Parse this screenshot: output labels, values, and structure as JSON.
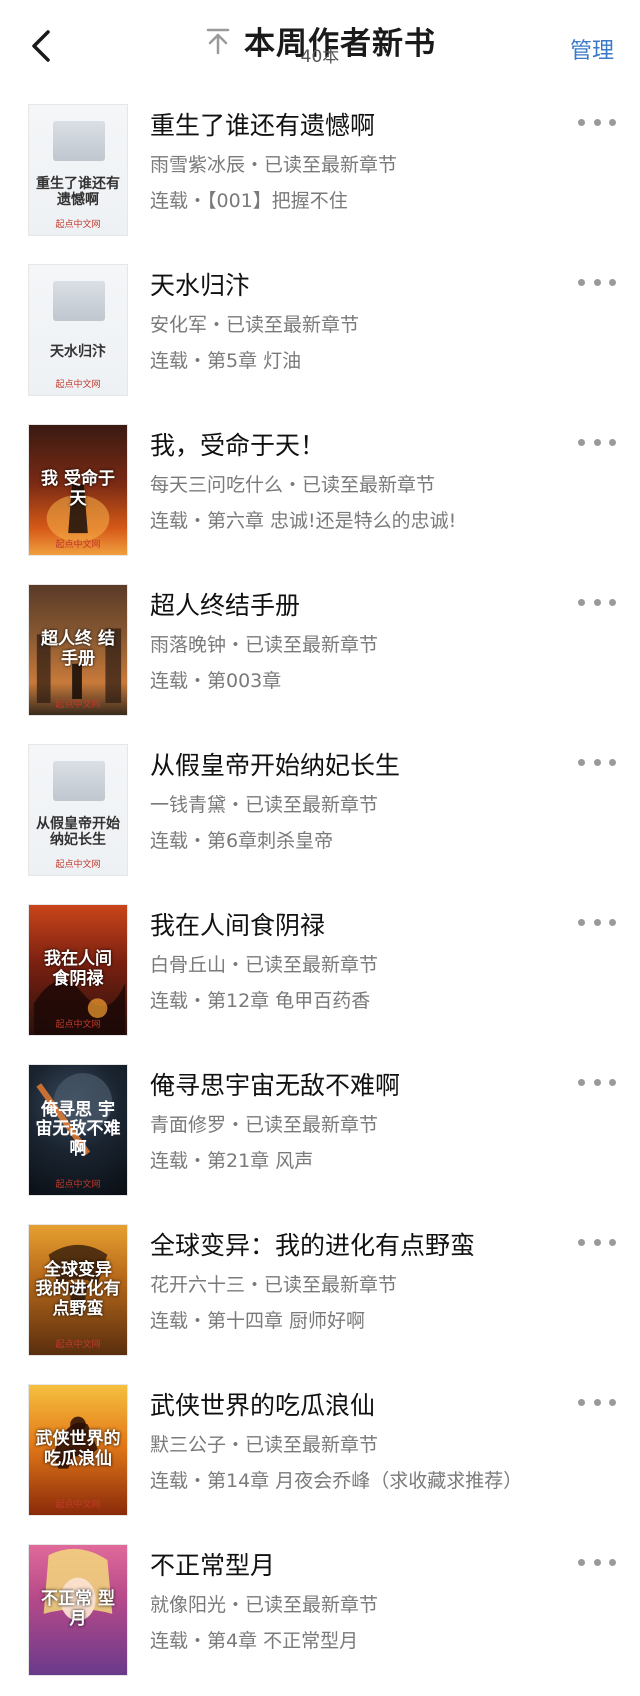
{
  "header": {
    "title": "本周作者新书",
    "count": "40本",
    "manage_label": "管理"
  },
  "icons": {
    "back": "chevron-left-icon",
    "pin": "pin-to-top-icon",
    "more": "more-dots-icon"
  },
  "books": [
    {
      "title": "重生了谁还有遗憾啊",
      "meta": "雨雪紫冰辰・已读至最新章节",
      "latest": "连载・【001】把握不住",
      "cover_text": "重生了谁还有遗憾啊",
      "cover_style": "light",
      "cover_publisher": "起点中文网"
    },
    {
      "title": "天水归汴",
      "meta": "安化军・已读至最新章节",
      "latest": "连载・第5章 灯油",
      "cover_text": "天水归汴",
      "cover_style": "light",
      "cover_publisher": "起点中文网"
    },
    {
      "title": "我，受命于天！",
      "meta": "每天三问吃什么・已读至最新章节",
      "latest": "连载・第六章 忠诚!还是特么的忠诚!",
      "cover_text": "我 受命于天",
      "cover_style": "fire",
      "cover_publisher": "起点中文网"
    },
    {
      "title": "超人终结手册",
      "meta": "雨落晚钟・已读至最新章节",
      "latest": "连载・第003章",
      "cover_text": "超人终 结手册",
      "cover_style": "city",
      "cover_publisher": "起点中文网"
    },
    {
      "title": "从假皇帝开始纳妃长生",
      "meta": "一钱青黛・已读至最新章节",
      "latest": "连载・第6章刺杀皇帝",
      "cover_text": "从假皇帝开始纳妃长生",
      "cover_style": "light",
      "cover_publisher": "起点中文网"
    },
    {
      "title": "我在人间食阴禄",
      "meta": "白骨丘山・已读至最新章节",
      "latest": "连载・第12章 龟甲百药香",
      "cover_text": "我在人间 食阴禄",
      "cover_style": "red",
      "cover_publisher": "起点中文网"
    },
    {
      "title": "俺寻思宇宙无敌不难啊",
      "meta": "青面修罗・已读至最新章节",
      "latest": "连载・第21章 风声",
      "cover_text": "俺寻思 宇宙无敌不难啊",
      "cover_style": "space",
      "cover_publisher": "起点中文网"
    },
    {
      "title": "全球变异：我的进化有点野蛮",
      "meta": "花开六十三・已读至最新章节",
      "latest": "连载・第十四章 厨师好啊",
      "cover_text": "全球变异 我的进化有点野蛮",
      "cover_style": "dragon",
      "cover_publisher": "起点中文网"
    },
    {
      "title": "武侠世界的吃瓜浪仙",
      "meta": "默三公子・已读至最新章节",
      "latest": "连载・第14章 月夜会乔峰（求收藏求推荐）",
      "cover_text": "武侠世界的 吃瓜浪仙",
      "cover_style": "horse",
      "cover_publisher": "起点中文网"
    },
    {
      "title": "不正常型月",
      "meta": "就像阳光・已读至最新章节",
      "latest": "连载・第4章 不正常型月",
      "cover_text": "不正常 型月",
      "cover_style": "anime",
      "cover_publisher": ""
    }
  ]
}
